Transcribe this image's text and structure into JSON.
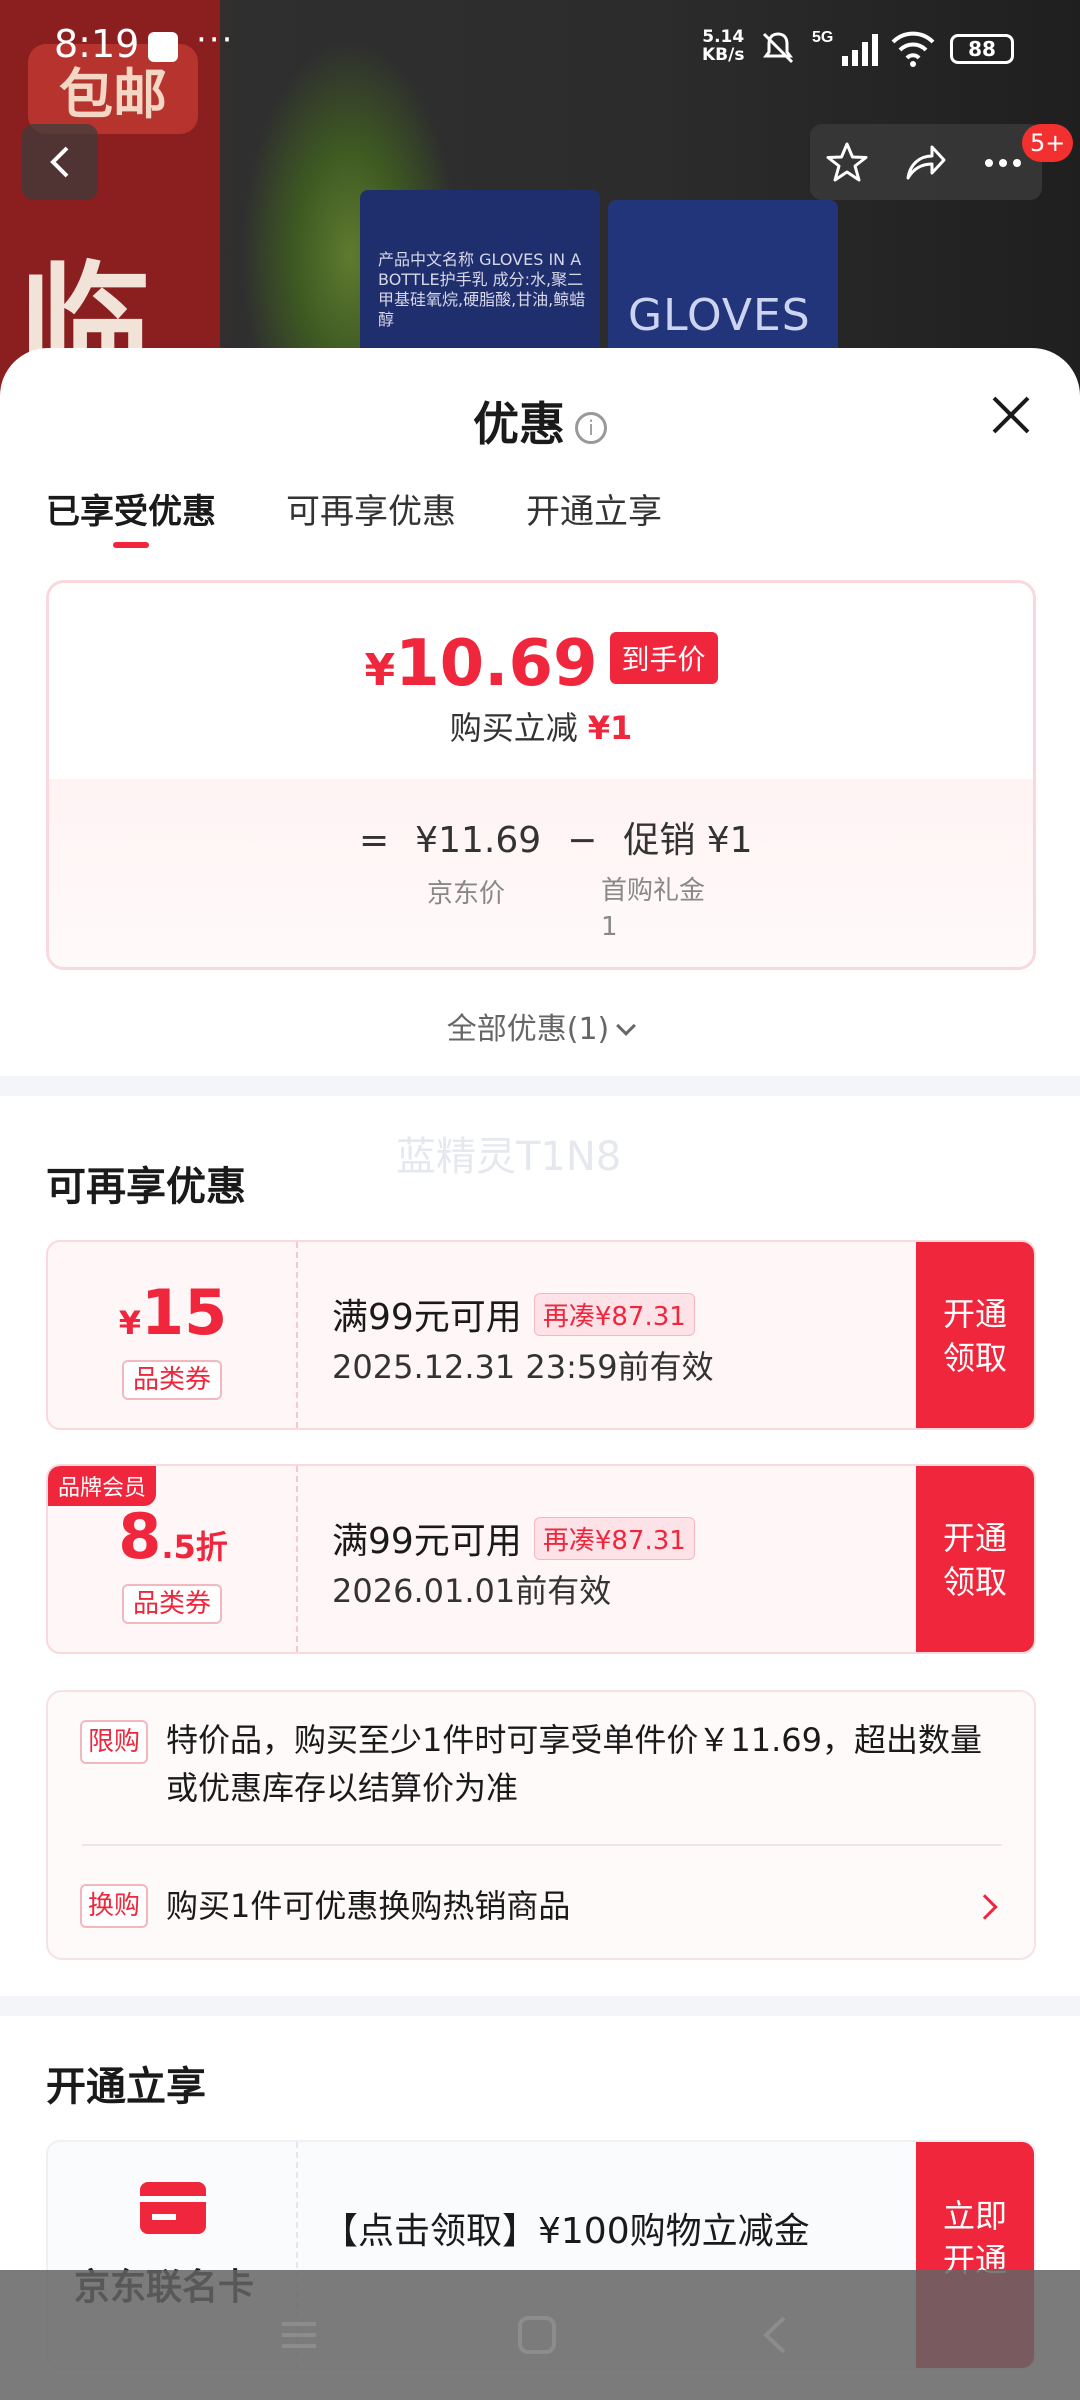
{
  "status_bar": {
    "time": "8:19",
    "overflow": "···",
    "net_speed": "5.14",
    "net_unit": "KB/s",
    "network": "5G",
    "battery": "88"
  },
  "background": {
    "badge": "包邮",
    "big_char": "临",
    "box_text": "产品中文名称 GLOVES IN A BOTTLE护手乳 成分:水,聚二甲基硅氧烷,硬脂酸,甘油,鲸蜡醇",
    "box_brand": "GLOVES"
  },
  "top_actions": {
    "notif_badge": "5+"
  },
  "sheet": {
    "title": "优惠",
    "info_glyph": "i",
    "tabs": [
      "已享受优惠",
      "可再享优惠",
      "开通立享"
    ],
    "active_tab": 0
  },
  "price_summary": {
    "currency": "¥",
    "final_price": "10.69",
    "final_tag": "到手价",
    "reduce_label": "购买立减",
    "reduce_value": "¥1",
    "eq": "=",
    "jd_price": "¥11.69",
    "minus": "−",
    "promo": "促销 ¥1",
    "jd_price_label": "京东价",
    "promo_label_line1": "首购礼金",
    "promo_label_line2": "1"
  },
  "all_offers": "全部优惠(1)",
  "watermark": "蓝精灵T1N8",
  "section_more": {
    "title": "可再享优惠",
    "coupons": [
      {
        "member_tag": "",
        "amount_prefix": "¥",
        "amount": "15",
        "amount_suffix": "",
        "kind": "品类券",
        "condition": "满99元可用",
        "more": "再凑¥87.31",
        "valid": "2025.12.31 23:59前有效",
        "action_line1": "开通",
        "action_line2": "领取"
      },
      {
        "member_tag": "品牌会员",
        "amount_prefix": "",
        "amount": "8",
        "amount_suffix": ".5折",
        "kind": "品类券",
        "condition": "满99元可用",
        "more": "再凑¥87.31",
        "valid": "2026.01.01前有效",
        "action_line1": "开通",
        "action_line2": "领取"
      }
    ],
    "rules": [
      {
        "tag": "限购",
        "text": "特价品，购买至少1件时可享受单件价￥11.69，超出数量或优惠库存以结算价为准"
      },
      {
        "tag": "换购",
        "text": "购买1件可优惠换购热销商品"
      }
    ]
  },
  "section_open": {
    "title": "开通立享",
    "card_name": "京东联名卡",
    "card_title": "【点击领取】¥100购物立减金",
    "action_line1": "立即",
    "action_line2": "开通"
  },
  "colors": {
    "accent": "#f0263c",
    "coupon_bg": "#fff6f7",
    "divider": "#f4f5f9"
  },
  "icons": {
    "back": "chevron-left-icon",
    "star": "star-icon",
    "share": "share-icon",
    "more": "more-dots-icon",
    "close": "close-icon",
    "info": "info-icon",
    "chevron_down": "chevron-down-icon",
    "chevron_right": "chevron-right-icon",
    "card": "credit-card-icon",
    "nav_menu": "menu-icon",
    "nav_home": "home-square-icon",
    "nav_back": "back-triangle-icon"
  }
}
